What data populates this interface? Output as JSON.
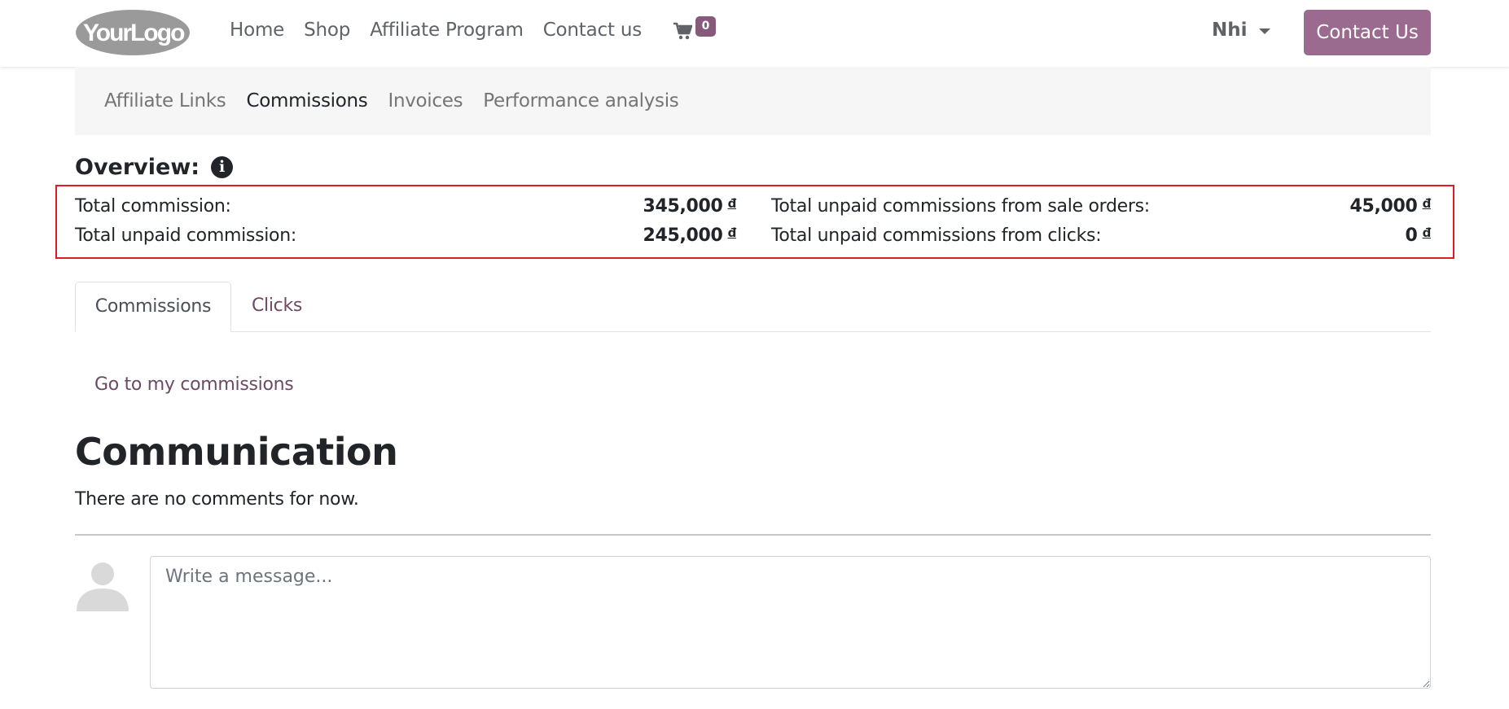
{
  "header": {
    "logo_text": "YourLogo",
    "nav": [
      "Home",
      "Shop",
      "Affiliate Program",
      "Contact us"
    ],
    "cart_count": "0",
    "user_name": "Nhi",
    "contact_button": "Contact Us"
  },
  "subnav": {
    "items": [
      "Affiliate Links",
      "Commissions",
      "Invoices",
      "Performance analysis"
    ],
    "active": "Commissions"
  },
  "overview": {
    "title": "Overview:",
    "info_icon_glyph": "i",
    "currency": "đ",
    "stats": [
      {
        "label": "Total commission:",
        "value": "345,000"
      },
      {
        "label": "Total unpaid commission:",
        "value": "245,000"
      },
      {
        "label": "Total unpaid commissions from sale orders:",
        "value": "45,000"
      },
      {
        "label": "Total unpaid commissions from clicks:",
        "value": "0"
      }
    ]
  },
  "tabs": {
    "items": [
      "Commissions",
      "Clicks"
    ],
    "active": "Commissions"
  },
  "commissions_link": "Go to my commissions",
  "communication": {
    "title": "Communication",
    "empty_text": "There are no comments for now.",
    "message_placeholder": "Write a message..."
  },
  "colors": {
    "brand": "#9a6b8f",
    "badge": "#875a7b",
    "link": "#6d4a63",
    "highlight_border": "#e01b24"
  }
}
